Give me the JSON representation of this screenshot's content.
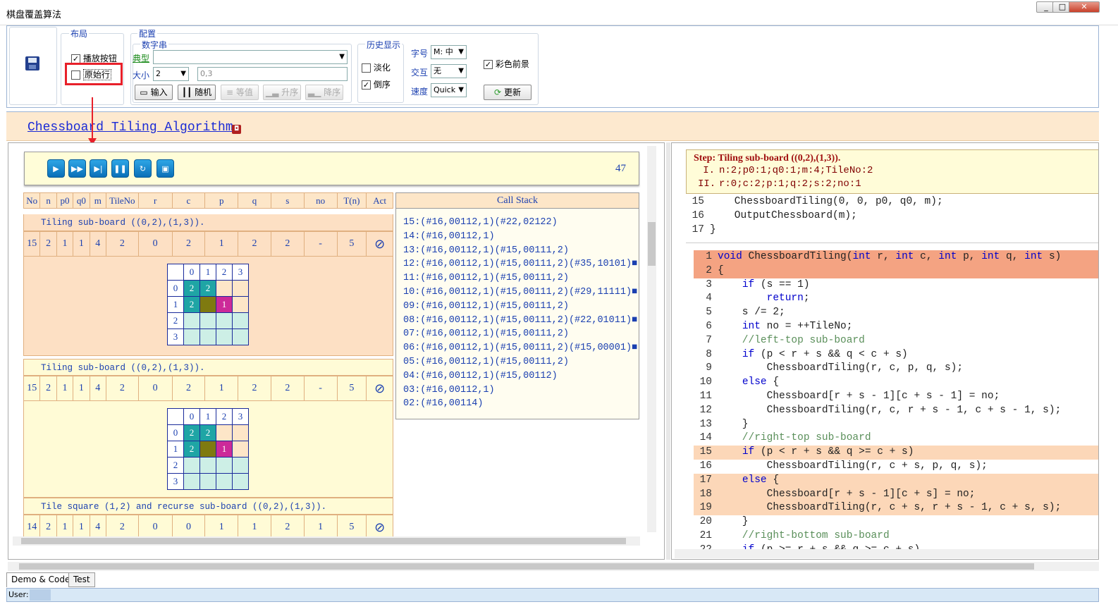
{
  "window": {
    "title": "棋盘覆盖算法",
    "min": "_",
    "max": "□",
    "close": "✕"
  },
  "toolbar": {
    "layout_group": "布局",
    "play_buttons": "播放按钮",
    "raw_line": "原始行",
    "config_group": "配置",
    "digit_string": "数字串",
    "typical_label": "典型",
    "size_label": "大小",
    "size_value": "2",
    "input_value": "0,3",
    "btn_input": "输入",
    "btn_random": "随机",
    "btn_equal": "等值",
    "btn_asc": "升序",
    "btn_desc": "降序",
    "history_group": "历史显示",
    "fade": "淡化",
    "reverse": "倒序",
    "font_label": "字号",
    "font_value": "M: 中",
    "interact_label": "交互",
    "interact_value": "无",
    "speed_label": "速度",
    "speed_value": "Quick",
    "color_fg": "彩色前景",
    "update_btn": "更新"
  },
  "banner": {
    "title": "Chessboard Tiling Algorithm"
  },
  "player": {
    "counter": "47"
  },
  "table": {
    "headers": [
      "No",
      "n",
      "p0",
      "q0",
      "m",
      "TileNo",
      "r",
      "c",
      "p",
      "q",
      "s",
      "no",
      "T(n)",
      "Act"
    ],
    "blocks": [
      {
        "desc": "Tiling sub-board ((0,2),(1,3)).",
        "row": [
          "15",
          "2",
          "1",
          "1",
          "4",
          "2",
          "0",
          "2",
          "1",
          "2",
          "2",
          "-",
          "5",
          "⊘"
        ]
      },
      {
        "desc": "Tiling sub-board ((0,2),(1,3)).",
        "row": [
          "15",
          "2",
          "1",
          "1",
          "4",
          "2",
          "0",
          "2",
          "1",
          "2",
          "2",
          "-",
          "5",
          "⊘"
        ]
      },
      {
        "desc": "Tile square (1,2) and recurse sub-board ((0,2),(1,3)).",
        "row": [
          "14",
          "2",
          "1",
          "1",
          "4",
          "2",
          "0",
          "0",
          "1",
          "1",
          "2",
          "1",
          "5",
          "⊘"
        ]
      }
    ],
    "board": {
      "cols": [
        "0",
        "1",
        "2",
        "3"
      ],
      "rows": [
        [
          "0",
          "2",
          "2",
          "",
          ""
        ],
        [
          "1",
          "2",
          "",
          "1",
          ""
        ],
        [
          "2",
          "",
          "",
          "",
          ""
        ],
        [
          "3",
          "",
          "",
          "",
          ""
        ]
      ],
      "colors": {
        "teal": "#1fa5a5",
        "olive": "#7f7a10",
        "magenta": "#cc2a99",
        "mint": "#cdefe6",
        "peach": "#fde6c8"
      }
    }
  },
  "callstack": {
    "title": "Call Stack",
    "lines": [
      "15:(#16,00112,1)(#22,02122)",
      "14:(#16,00112,1)",
      "13:(#16,00112,1)(#15,00111,2)",
      "12:(#16,00112,1)(#15,00111,2)(#35,10101)■",
      "11:(#16,00112,1)(#15,00111,2)",
      "10:(#16,00112,1)(#15,00111,2)(#29,11111)■",
      "09:(#16,00112,1)(#15,00111,2)",
      "08:(#16,00112,1)(#15,00111,2)(#22,01011)■",
      "07:(#16,00112,1)(#15,00111,2)",
      "06:(#16,00112,1)(#15,00111,2)(#15,00001)■",
      "05:(#16,00112,1)(#15,00111,2)",
      "04:(#16,00112,1)(#15,00112)",
      "03:(#16,00112,1)",
      "02:(#16,00114)"
    ]
  },
  "step": {
    "label": "Step:",
    "text": "Tiling sub-board ((0,2),(1,3)).",
    "lines": [
      {
        "num": "I.",
        "text": "n:2;p0:1;q0:1;m:4;TileNo:2"
      },
      {
        "num": "II.",
        "text": "r:0;c:2;p:1;q:2;s:2;no:1"
      }
    ]
  },
  "code_top": [
    {
      "n": "15",
      "t": "    ChessboardTiling(0, 0, p0, q0, m);"
    },
    {
      "n": "16",
      "t": "    OutputChessboard(m);"
    },
    {
      "n": "17",
      "t": "}"
    }
  ],
  "code": [
    {
      "n": "1",
      "t": "void ChessboardTiling(int r, int c, int p, int q, int s)"
    },
    {
      "n": "2",
      "t": "{"
    },
    {
      "n": "3",
      "t": "    if (s == 1)"
    },
    {
      "n": "4",
      "t": "        return;"
    },
    {
      "n": "5",
      "t": "    s /= 2;"
    },
    {
      "n": "6",
      "t": "    int no = ++TileNo;"
    },
    {
      "n": "7",
      "t": "    //left-top sub-board"
    },
    {
      "n": "8",
      "t": "    if (p < r + s && q < c + s)"
    },
    {
      "n": "9",
      "t": "        ChessboardTiling(r, c, p, q, s);"
    },
    {
      "n": "10",
      "t": "    else {"
    },
    {
      "n": "11",
      "t": "        Chessboard[r + s - 1][c + s - 1] = no;"
    },
    {
      "n": "12",
      "t": "        ChessboardTiling(r, c, r + s - 1, c + s - 1, s);"
    },
    {
      "n": "13",
      "t": "    }"
    },
    {
      "n": "14",
      "t": "    //right-top sub-board"
    },
    {
      "n": "15",
      "t": "    if (p < r + s && q >= c + s)"
    },
    {
      "n": "16",
      "t": "        ChessboardTiling(r, c + s, p, q, s);"
    },
    {
      "n": "17",
      "t": "    else {"
    },
    {
      "n": "18",
      "t": "        Chessboard[r + s - 1][c + s] = no;"
    },
    {
      "n": "19",
      "t": "        ChessboardTiling(r, c + s, r + s - 1, c + s, s);"
    },
    {
      "n": "20",
      "t": "    }"
    },
    {
      "n": "21",
      "t": "    //right-bottom sub-board"
    },
    {
      "n": "22",
      "t": "    if (p >= r + s && q >= c + s)"
    }
  ],
  "tabs": [
    "Demo & Code",
    "Test"
  ],
  "status": {
    "user": "User:"
  }
}
